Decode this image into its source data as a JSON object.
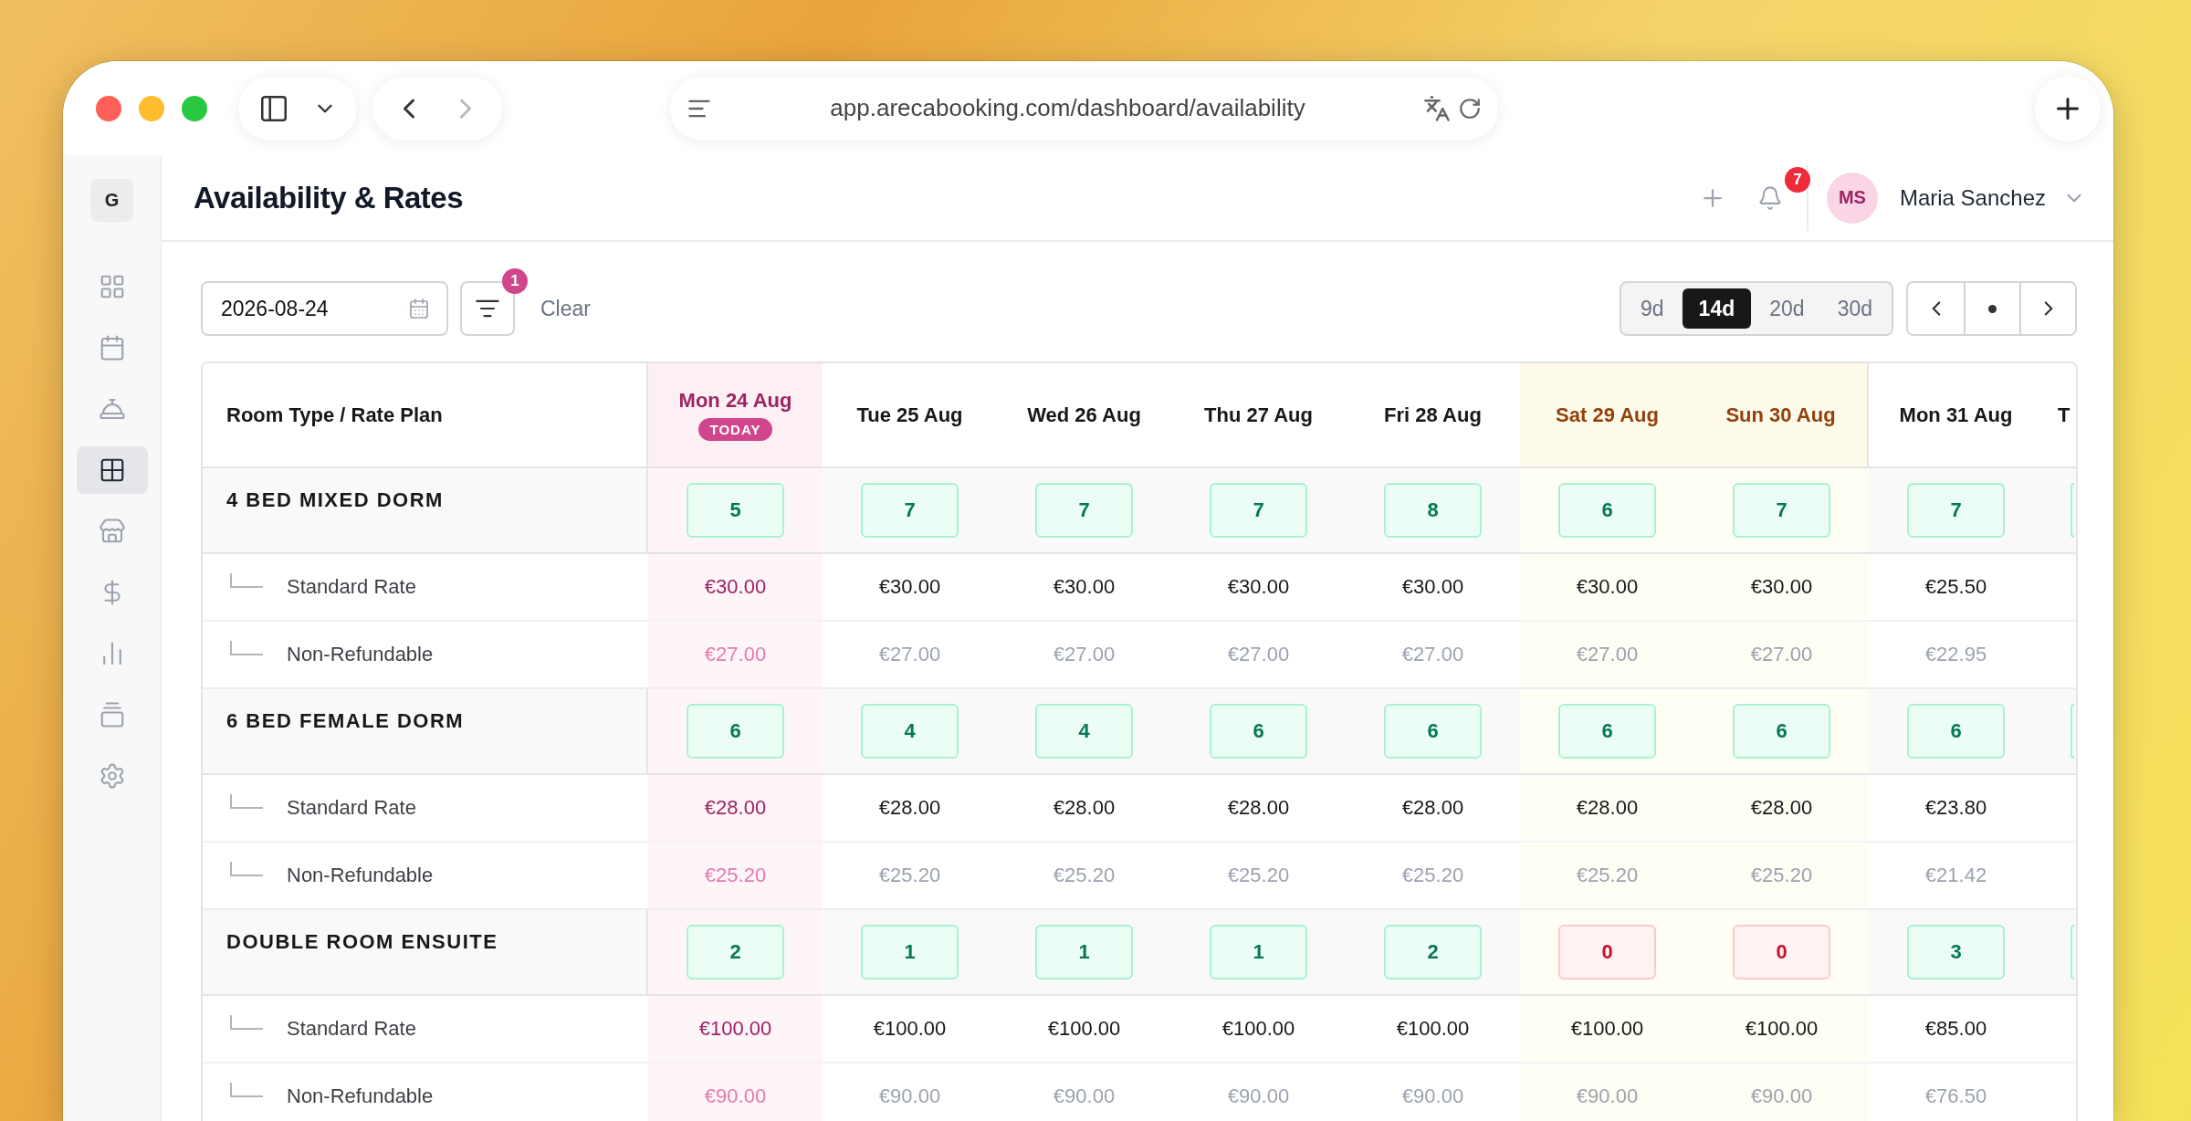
{
  "browser": {
    "url": "app.arecabooking.com/dashboard/availability"
  },
  "sidebar": {
    "logo": "G",
    "items": [
      {
        "selected": false
      },
      {
        "selected": false
      },
      {
        "selected": false
      },
      {
        "selected": true
      },
      {
        "selected": false
      },
      {
        "selected": false
      },
      {
        "selected": false
      },
      {
        "selected": false
      },
      {
        "selected": false
      }
    ]
  },
  "header": {
    "title": "Availability & Rates",
    "notification_count": "7",
    "user": {
      "initials": "MS",
      "name": "Maria Sanchez"
    }
  },
  "toolbar": {
    "date": "2026-08-24",
    "filter_count": "1",
    "clear": "Clear",
    "ranges": [
      {
        "label": "9d",
        "selected": false
      },
      {
        "label": "14d",
        "selected": true
      },
      {
        "label": "20d",
        "selected": false
      },
      {
        "label": "30d",
        "selected": false
      }
    ]
  },
  "table": {
    "corner": "Room Type / Rate Plan",
    "columns": [
      {
        "label": "Mon 24 Aug",
        "kind": "today",
        "badge": "TODAY"
      },
      {
        "label": "Tue 25 Aug",
        "kind": "weekday"
      },
      {
        "label": "Wed 26 Aug",
        "kind": "weekday"
      },
      {
        "label": "Thu 27 Aug",
        "kind": "weekday"
      },
      {
        "label": "Fri 28 Aug",
        "kind": "weekday"
      },
      {
        "label": "Sat 29 Aug",
        "kind": "weekend"
      },
      {
        "label": "Sun 30 Aug",
        "kind": "weekend"
      },
      {
        "label": "Mon 31 Aug",
        "kind": "weekday"
      },
      {
        "label": "T",
        "kind": "partial"
      }
    ],
    "rooms": [
      {
        "name": "4 BED MIXED DORM",
        "availability": [
          {
            "value": "5",
            "sold_out": false
          },
          {
            "value": "7",
            "sold_out": false
          },
          {
            "value": "7",
            "sold_out": false
          },
          {
            "value": "7",
            "sold_out": false
          },
          {
            "value": "8",
            "sold_out": false
          },
          {
            "value": "6",
            "sold_out": false
          },
          {
            "value": "7",
            "sold_out": false
          },
          {
            "value": "7",
            "sold_out": false
          },
          {
            "sold_out": false
          }
        ],
        "rates": [
          {
            "name": "Standard Rate",
            "kind": "standard",
            "prices": [
              "€30.00",
              "€30.00",
              "€30.00",
              "€30.00",
              "€30.00",
              "€30.00",
              "€30.00",
              "€25.50"
            ]
          },
          {
            "name": "Non-Refundable",
            "kind": "nonrefundable",
            "prices": [
              "€27.00",
              "€27.00",
              "€27.00",
              "€27.00",
              "€27.00",
              "€27.00",
              "€27.00",
              "€22.95"
            ]
          }
        ]
      },
      {
        "name": "6 BED FEMALE DORM",
        "availability": [
          {
            "value": "6",
            "sold_out": false
          },
          {
            "value": "4",
            "sold_out": false
          },
          {
            "value": "4",
            "sold_out": false
          },
          {
            "value": "6",
            "sold_out": false
          },
          {
            "value": "6",
            "sold_out": false
          },
          {
            "value": "6",
            "sold_out": false
          },
          {
            "value": "6",
            "sold_out": false
          },
          {
            "value": "6",
            "sold_out": false
          },
          {
            "sold_out": false
          }
        ],
        "rates": [
          {
            "name": "Standard Rate",
            "kind": "standard",
            "prices": [
              "€28.00",
              "€28.00",
              "€28.00",
              "€28.00",
              "€28.00",
              "€28.00",
              "€28.00",
              "€23.80"
            ]
          },
          {
            "name": "Non-Refundable",
            "kind": "nonrefundable",
            "prices": [
              "€25.20",
              "€25.20",
              "€25.20",
              "€25.20",
              "€25.20",
              "€25.20",
              "€25.20",
              "€21.42"
            ]
          }
        ]
      },
      {
        "name": "DOUBLE ROOM ENSUITE",
        "availability": [
          {
            "value": "2",
            "sold_out": false
          },
          {
            "value": "1",
            "sold_out": false
          },
          {
            "value": "1",
            "sold_out": false
          },
          {
            "value": "1",
            "sold_out": false
          },
          {
            "value": "2",
            "sold_out": false
          },
          {
            "value": "0",
            "sold_out": true
          },
          {
            "value": "0",
            "sold_out": true
          },
          {
            "value": "3",
            "sold_out": false
          },
          {
            "sold_out": false
          }
        ],
        "rates": [
          {
            "name": "Standard Rate",
            "kind": "standard",
            "prices": [
              "€100.00",
              "€100.00",
              "€100.00",
              "€100.00",
              "€100.00",
              "€100.00",
              "€100.00",
              "€85.00"
            ]
          },
          {
            "name": "Non-Refundable",
            "kind": "nonrefundable",
            "prices": [
              "€90.00",
              "€90.00",
              "€90.00",
              "€90.00",
              "€90.00",
              "€90.00",
              "€90.00",
              "€76.50"
            ]
          }
        ]
      }
    ]
  }
}
